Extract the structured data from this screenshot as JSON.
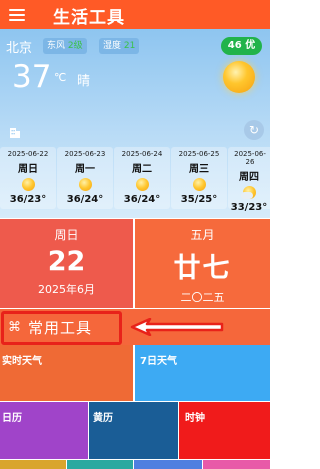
{
  "app": {
    "title": "生活工具"
  },
  "weather": {
    "city": "北京",
    "wind": {
      "label": "东风",
      "level": "2级"
    },
    "humidity": {
      "label": "湿度",
      "value": "21"
    },
    "aqi": "46 优",
    "temperature": "37",
    "unit": "℃",
    "condition": "晴",
    "forecast": [
      {
        "date": "2025-06-22",
        "weekday": "周日",
        "icon": "sunny",
        "temp": "36/23°"
      },
      {
        "date": "2025-06-23",
        "weekday": "周一",
        "icon": "sunny",
        "temp": "36/24°"
      },
      {
        "date": "2025-06-24",
        "weekday": "周二",
        "icon": "sunny",
        "temp": "36/24°"
      },
      {
        "date": "2025-06-25",
        "weekday": "周三",
        "icon": "sunny",
        "temp": "35/25°"
      },
      {
        "date": "2025-06-26",
        "weekday": "周四",
        "icon": "partly-cloudy",
        "temp": "33/23°"
      }
    ]
  },
  "calendar": {
    "solar": {
      "weekday": "周日",
      "day": "22",
      "month_year": "2025年6月"
    },
    "lunar": {
      "month": "五月",
      "day": "廿七",
      "year": "二〇二五"
    }
  },
  "section": {
    "title": "常用工具",
    "icon": "command-icon"
  },
  "tools": [
    {
      "label": "实时天气",
      "color": "#ef6a35"
    },
    {
      "label": "7日天气",
      "color": "#3daaf3"
    },
    {
      "label": "日历",
      "color": "#a044c9"
    },
    {
      "label": "黄历",
      "color": "#1a5d96"
    },
    {
      "label": "时钟",
      "color": "#f01b1b"
    }
  ]
}
